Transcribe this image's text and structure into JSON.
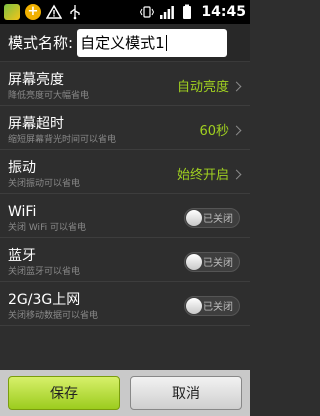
{
  "status_bar": {
    "time": "14:45",
    "icons": [
      "image-icon",
      "plus-icon",
      "warning-icon",
      "usb-icon",
      "vibrate-icon",
      "signal-icon",
      "battery-icon"
    ]
  },
  "header": {
    "label": "模式名称:",
    "input_value": "自定义模式1"
  },
  "settings": [
    {
      "title": "屏幕亮度",
      "subtitle": "降低亮度可大幅省电",
      "value": "自动亮度"
    },
    {
      "title": "屏幕超时",
      "subtitle": "缩短屏幕背光时间可以省电",
      "value": "60秒"
    },
    {
      "title": "振动",
      "subtitle": "关闭振动可以省电",
      "value": "始终开启"
    },
    {
      "title": "WiFi",
      "subtitle": "关闭 WiFi 可以省电",
      "toggle": "已关闭"
    },
    {
      "title": "蓝牙",
      "subtitle": "关闭蓝牙可以省电",
      "toggle": "已关闭"
    },
    {
      "title": "2G/3G上网",
      "subtitle": "关闭移动数据可以省电",
      "toggle": "已关闭"
    }
  ],
  "buttons": {
    "save": "保存",
    "cancel": "取消"
  },
  "colors": {
    "accent": "#a0d020",
    "background": "#2e2e2e"
  }
}
